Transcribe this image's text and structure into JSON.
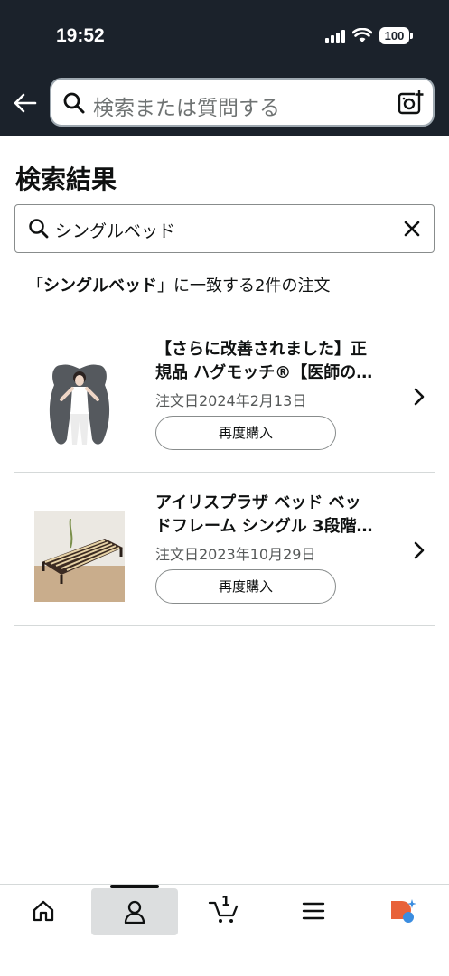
{
  "status_bar": {
    "time": "19:52",
    "battery": "100"
  },
  "header": {
    "search_placeholder": "検索または質問する"
  },
  "page": {
    "title": "検索結果",
    "filter_value": "シングルベッド",
    "summary_prefix": "「",
    "summary_query": "シングルベッド",
    "summary_suffix": "」に一致する2件の注文"
  },
  "orders": [
    {
      "title_line1": "【さらに改善されました】正",
      "title_line2": "規品 ハグモッチ®【医師の…",
      "date": "注文日2024年2月13日",
      "rebuy_label": "再度購入"
    },
    {
      "title_line1": "アイリスプラザ ベッド ベッ",
      "title_line2": "ドフレーム シングル 3段階…",
      "date": "注文日2023年10月29日",
      "rebuy_label": "再度購入"
    }
  ],
  "bottom_nav": {
    "cart_count": "1",
    "items": [
      "home-icon",
      "account-icon",
      "cart-icon",
      "menu-icon",
      "rufus-ai-icon"
    ]
  },
  "colors": {
    "topbar": "#1b222b",
    "nav_active": "#dcdedf",
    "ai_orange": "#e8623a",
    "ai_blue": "#3b8de0"
  }
}
